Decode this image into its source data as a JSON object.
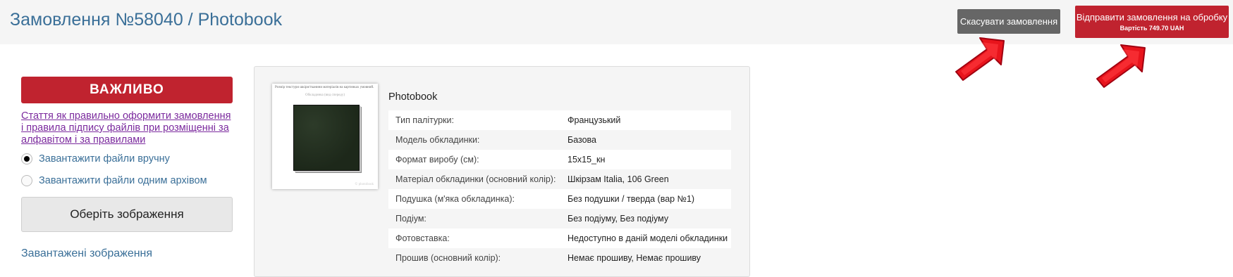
{
  "header": {
    "title": "Замовлення №58040 / Photobook",
    "cancel_label": "Скасувати замовлення",
    "submit_label": "Відправити замовлення на обробку",
    "submit_price": "Вартість 749.70 UAH"
  },
  "left": {
    "important": "ВАЖЛИВО",
    "article_link": "Стаття як правильно оформити замовлення і правила підпису файлів при розміщенні за алфавітом і за правилами",
    "radio_manual": "Завантажити файли вручну",
    "radio_archive": "Завантажити файли одним архівом",
    "radio_selected": "manual",
    "choose_images": "Оберіть зображення",
    "uploaded_images": "Завантажені зображення"
  },
  "product": {
    "name": "Photobook",
    "thumbnail_note": "Розмір текстури шкіри/тканини матеріалів на картинках умовний.",
    "thumbnail_cover_label": "Обкладинка (вид спереду)",
    "thumbnail_watermark": "© photobook",
    "specs": [
      {
        "label": "Тип палітурки:",
        "value": "Французький"
      },
      {
        "label": "Модель обкладинки:",
        "value": "Базова"
      },
      {
        "label": "Формат виробу (см):",
        "value": "15x15_кн"
      },
      {
        "label": "Матеріал обкладинки (основний колір):",
        "value": "Шкірзам Italia, 106 Green"
      },
      {
        "label": "Подушка (м'яка обкладинка):",
        "value": "Без подушки / тверда (вар №1)"
      },
      {
        "label": "Подіум:",
        "value": "Без подіуму, Без подіуму"
      },
      {
        "label": "Фотовставка:",
        "value": "Недоступно в даній моделі обкладинки"
      },
      {
        "label": "Прошив (основний колір):",
        "value": "Немає прошиву, Немає прошиву"
      }
    ]
  },
  "colors": {
    "accent_red": "#c0232f",
    "title_blue": "#3a6f98",
    "link_purple": "#7b2a9e",
    "cancel_gray": "#666666"
  }
}
